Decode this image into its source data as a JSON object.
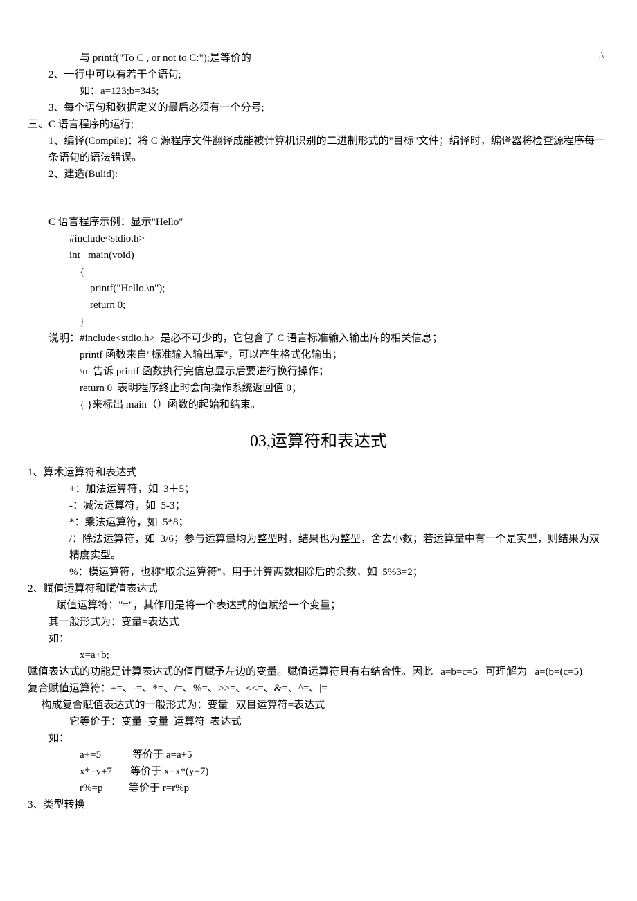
{
  "page_marker": ".\\",
  "lines": {
    "l01": "与 printf(\"To C , or not to C:\");是等价的",
    "l02": "2、一行中可以有若干个语句;",
    "l03": "如：a=123;b=345;",
    "l04": "3、每个语句和数据定义的最后必须有一个分号;",
    "l05": "三、C 语言程序的运行;",
    "l06": "1、编译(Compile)：将 C 源程序文件翻译成能被计算机识别的二进制形式的\"目标\"文件；编译时，编译器将检查源程序每一条语句的语法错误。",
    "l07": "2、建造(Bulid):",
    "l08": "C 语言程序示例：显示\"Hello\"",
    "l09": "#include<stdio.h>",
    "l10": "int   main(void)",
    "l11": "{",
    "l12": "printf(\"Hello.\\n\");",
    "l13": "return 0;",
    "l14": "}",
    "l15": "说明：#include<stdio.h>  是必不可少的，它包含了 C 语言标准输入输出库的相关信息；",
    "l16": "printf 函数来自\"标准输入输出库\"，可以产生格式化输出；",
    "l17": "\\n  告诉 printf 函数执行完信息显示后要进行换行操作；",
    "l18": "return 0  表明程序终止时会向操作系统返回值 0；",
    "l19": "{ }来标出 main（）函数的起始和结束。",
    "section_title": "03,运算符和表达式",
    "l20": "1、算术运算符和表达式",
    "l21": "+：加法运算符，如  3＋5；",
    "l22": "-：减法运算符，如  5-3；",
    "l23": "*：乘法运算符，如  5*8；",
    "l24": "/：除法运算符，如  3/6；参与运算量均为整型时，结果也为整型，舍去小数；若运算量中有一个是实型，则结果为双精度实型。",
    "l25": "%：模运算符，也称\"取余运算符\"，用于计算两数相除后的余数，如  5%3=2；",
    "l26": "2、赋值运算符和赋值表达式",
    "l27": "   赋值运算符：\"=\"，其作用是将一个表达式的值赋给一个变量；",
    "l28": "其一般形式为：变量=表达式",
    "l29": "如：",
    "l30": "x=a+b;",
    "l31": "赋值表达式的功能是计算表达式的值再赋予左边的变量。赋值运算符具有右结合性。因此   a=b=c=5   可理解为   a=(b=(c=5)",
    "l32": "复合赋值运算符：+=、-=、*=、/=、%=、>>=、<<=、&=、^=、|=",
    "l33": "构成复合赋值表达式的一般形式为：变量   双目运算符=表达式",
    "l34": "它等价于：变量=变量  运算符  表达式",
    "l35": "如：",
    "l36": "a+=5            等价于 a=a+5",
    "l37": "x*=y+7       等价于 x=x*(y+7)",
    "l38": "r%=p          等价于 r=r%p",
    "l39": "3、类型转换"
  }
}
